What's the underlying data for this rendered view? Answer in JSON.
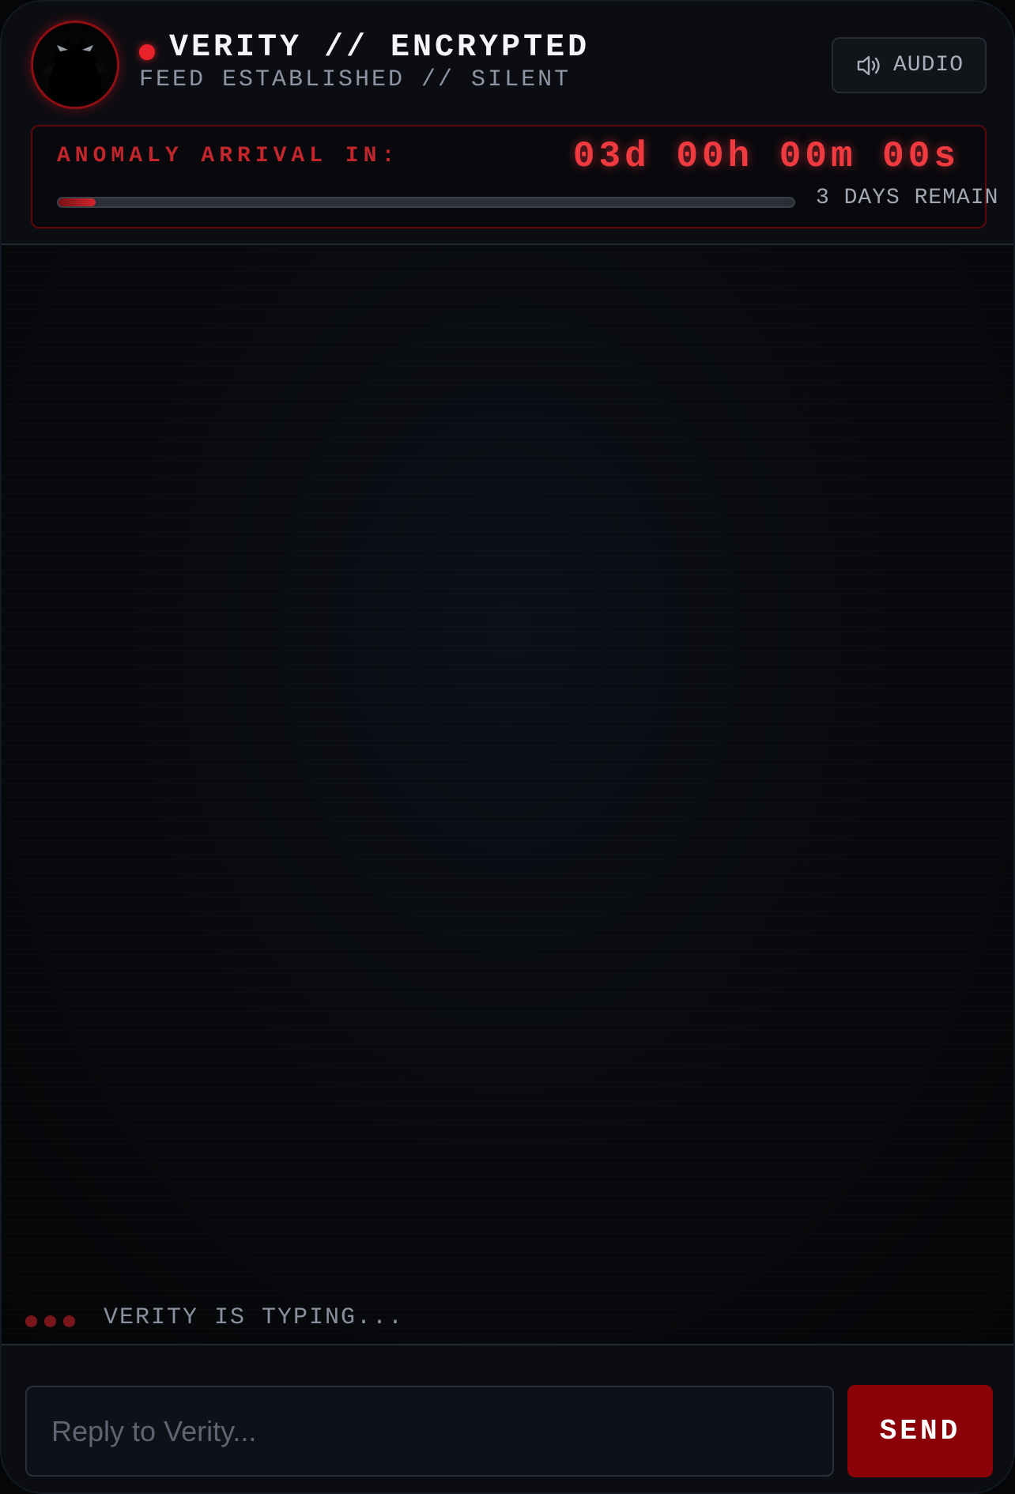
{
  "header": {
    "title": "VERITY // ENCRYPTED",
    "subtitle": "FEED ESTABLISHED // SILENT",
    "status_color": "#e8232b",
    "avatar_icon": "hooded-figure-icon",
    "audio_button": {
      "label": "AUDIO",
      "icon": "speaker-icon"
    }
  },
  "countdown": {
    "label": "ANOMALY ARRIVAL IN:",
    "time": "03d 00h 00m 00s",
    "remaining_text": "3 DAYS REMAIN",
    "progress_fraction": 0.05,
    "accent_color": "#ef3a40"
  },
  "feed": {
    "typing_indicator": "VERITY IS TYPING..."
  },
  "composer": {
    "placeholder": "Reply to Verity...",
    "value": "",
    "send_label": "SEND",
    "send_color": "#8a0207"
  }
}
